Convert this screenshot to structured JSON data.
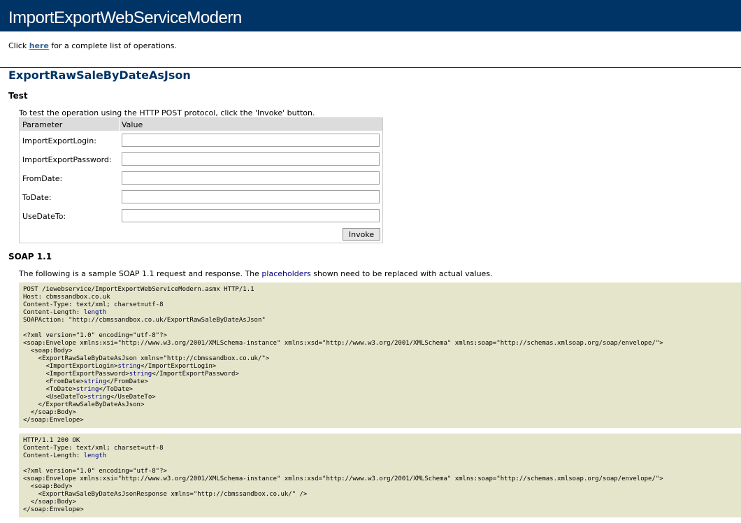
{
  "page": {
    "service_title": "ImportExportWebServiceModern",
    "intro_prefix": "Click ",
    "intro_link": "here",
    "intro_suffix": " for a complete list of operations."
  },
  "operation": {
    "name": "ExportRawSaleByDateAsJson",
    "test": {
      "heading": "Test",
      "description": "To test the operation using the HTTP POST protocol, click the 'Invoke' button.",
      "header_parameter": "Parameter",
      "header_value": "Value",
      "params": [
        {
          "label": "ImportExportLogin:",
          "value": ""
        },
        {
          "label": "ImportExportPassword:",
          "value": ""
        },
        {
          "label": "FromDate:",
          "value": ""
        },
        {
          "label": "ToDate:",
          "value": ""
        },
        {
          "label": "UseDateTo:",
          "value": ""
        }
      ],
      "invoke_label": "Invoke"
    },
    "soap11": {
      "heading": "SOAP 1.1",
      "desc_prefix": "The following is a sample SOAP 1.1 request and response. The ",
      "desc_placeholder": "placeholders",
      "desc_suffix": " shown need to be replaced with actual values.",
      "request": {
        "header_lines": [
          "POST /iewebservice/ImportExportWebServiceModern.asmx HTTP/1.1",
          "Host: cbmssandbox.co.uk",
          "Content-Type: text/xml; charset=utf-8"
        ],
        "content_length_prefix": "Content-Length: ",
        "content_length_placeholder": "length",
        "soapaction_line": "SOAPAction: \"http://cbmssandbox.co.uk/ExportRawSaleByDateAsJson\"",
        "xml_decl": "<?xml version=\"1.0\" encoding=\"utf-8\"?>",
        "envelope_open": "<soap:Envelope xmlns:xsi=\"http://www.w3.org/2001/XMLSchema-instance\" xmlns:xsd=\"http://www.w3.org/2001/XMLSchema\" xmlns:soap=\"http://schemas.xmlsoap.org/soap/envelope/\">",
        "body_open": "  <soap:Body>",
        "op_open": "    <ExportRawSaleByDateAsJson xmlns=\"http://cbmssandbox.co.uk/\">",
        "elements": [
          {
            "open": "      <ImportExportLogin>",
            "value": "string",
            "close": "</ImportExportLogin>"
          },
          {
            "open": "      <ImportExportPassword>",
            "value": "string",
            "close": "</ImportExportPassword>"
          },
          {
            "open": "      <FromDate>",
            "value": "string",
            "close": "</FromDate>"
          },
          {
            "open": "      <ToDate>",
            "value": "string",
            "close": "</ToDate>"
          },
          {
            "open": "      <UseDateTo>",
            "value": "string",
            "close": "</UseDateTo>"
          }
        ],
        "op_close": "    </ExportRawSaleByDateAsJson>",
        "body_close": "  </soap:Body>",
        "envelope_close": "</soap:Envelope>"
      },
      "response": {
        "header_lines": [
          "HTTP/1.1 200 OK",
          "Content-Type: text/xml; charset=utf-8"
        ],
        "content_length_prefix": "Content-Length: ",
        "content_length_placeholder": "length",
        "xml_decl": "<?xml version=\"1.0\" encoding=\"utf-8\"?>",
        "envelope_open": "<soap:Envelope xmlns:xsi=\"http://www.w3.org/2001/XMLSchema-instance\" xmlns:xsd=\"http://www.w3.org/2001/XMLSchema\" xmlns:soap=\"http://schemas.xmlsoap.org/soap/envelope/\">",
        "body_open": "  <soap:Body>",
        "response_element": "    <ExportRawSaleByDateAsJsonResponse xmlns=\"http://cbmssandbox.co.uk/\" />",
        "body_close": "  </soap:Body>",
        "envelope_close": "</soap:Envelope>"
      }
    }
  }
}
